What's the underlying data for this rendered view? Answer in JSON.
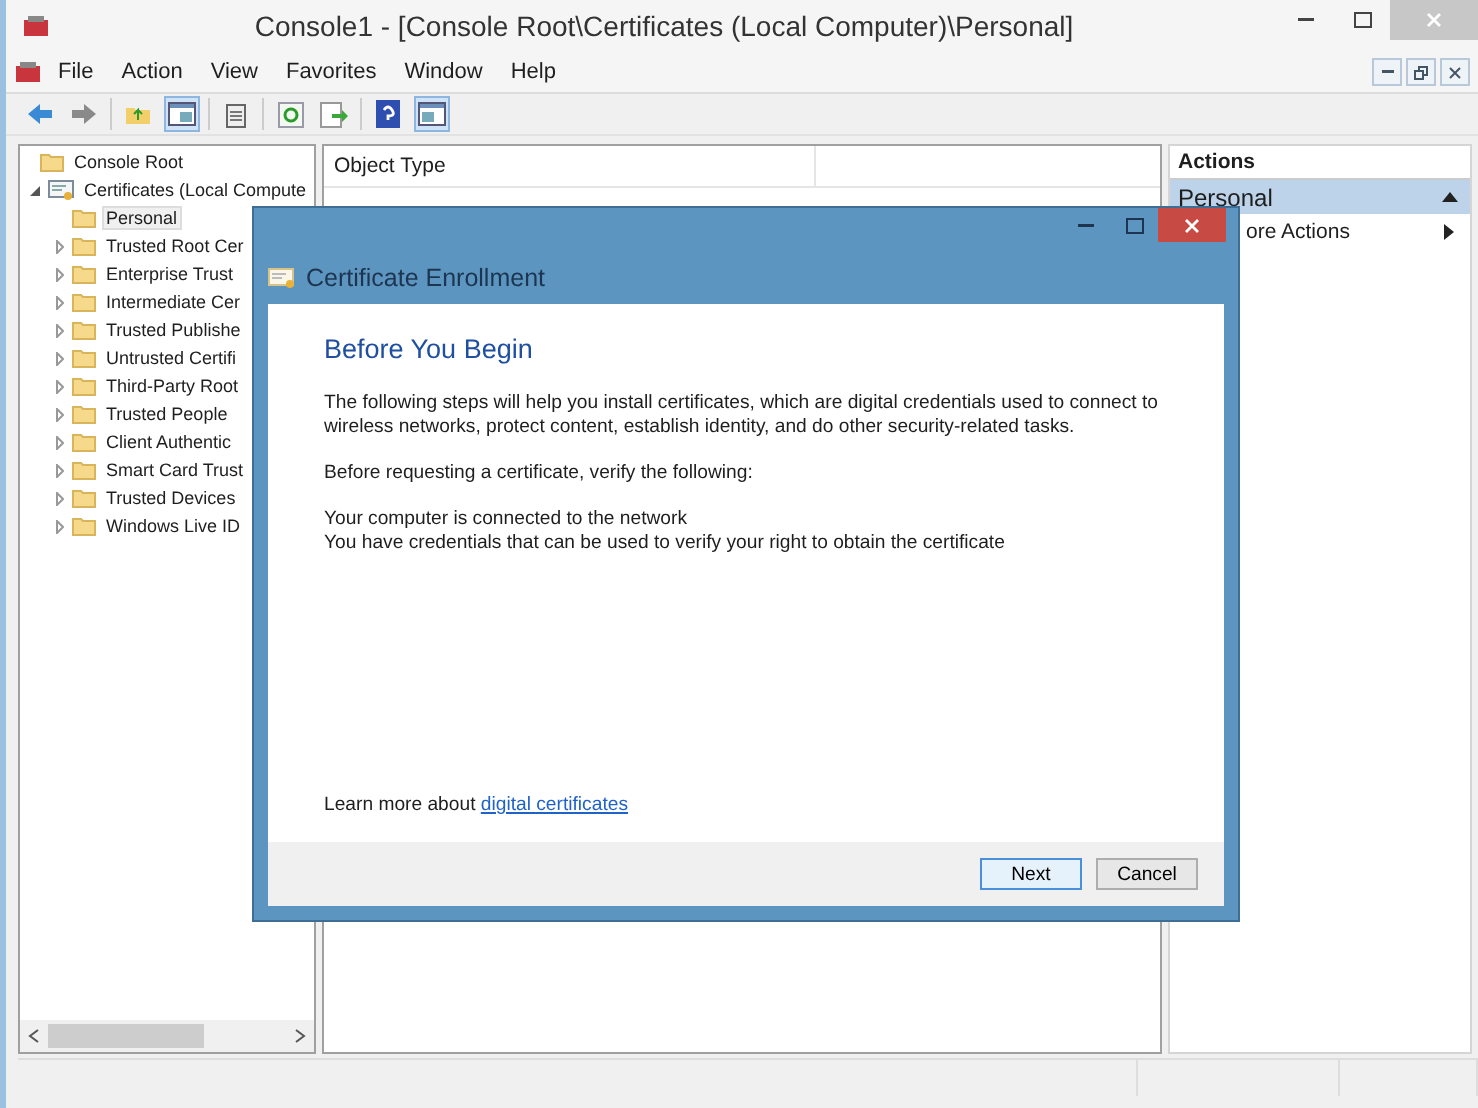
{
  "window": {
    "title": "Console1 - [Console Root\\Certificates (Local Computer)\\Personal]"
  },
  "menu": [
    "File",
    "Action",
    "View",
    "Favorites",
    "Window",
    "Help"
  ],
  "tree": [
    {
      "label": "Console Root",
      "selected": false,
      "children": [
        {
          "label": "Certificates (Local Compute",
          "selected": false,
          "expanded": true,
          "kind": "store",
          "children": [
            {
              "label": "Personal",
              "selected": true
            },
            {
              "label": "Trusted Root Cer",
              "selected": false,
              "expanded": false
            },
            {
              "label": "Enterprise Trust",
              "selected": false,
              "expanded": false
            },
            {
              "label": "Intermediate Cer",
              "selected": false,
              "expanded": false
            },
            {
              "label": "Trusted Publishe",
              "selected": false,
              "expanded": false
            },
            {
              "label": "Untrusted Certifi",
              "selected": false,
              "expanded": false
            },
            {
              "label": "Third-Party Root",
              "selected": false,
              "expanded": false
            },
            {
              "label": "Trusted People",
              "selected": false,
              "expanded": false
            },
            {
              "label": "Client Authentic",
              "selected": false,
              "expanded": false
            },
            {
              "label": "Smart Card Trust",
              "selected": false,
              "expanded": false
            },
            {
              "label": "Trusted Devices",
              "selected": false,
              "expanded": false
            },
            {
              "label": "Windows Live ID",
              "selected": false,
              "expanded": false
            }
          ]
        }
      ]
    }
  ],
  "columns": [
    "Object Type"
  ],
  "actions": {
    "title": "Actions",
    "sections": [
      {
        "label": "Personal",
        "expanded": true,
        "items": [
          "ore Actions"
        ]
      }
    ]
  },
  "dialog": {
    "title": "Certificate Enrollment",
    "heading": "Before You Begin",
    "paragraphs": [
      [
        "The following steps will help you install certificates, which are digital credentials used to connect to wireless networks, protect content, establish identity, and do other security-related tasks."
      ],
      [
        "Before requesting a certificate, verify the following:"
      ],
      [
        "Your computer is connected to the network",
        "You have credentials that can be used to verify your right to obtain the certificate"
      ]
    ],
    "learn_more": {
      "text": "Learn more about",
      "link": "digital certificates"
    },
    "buttons": [
      {
        "label": "Next",
        "default": true
      },
      {
        "label": "Cancel",
        "default": false
      }
    ]
  }
}
